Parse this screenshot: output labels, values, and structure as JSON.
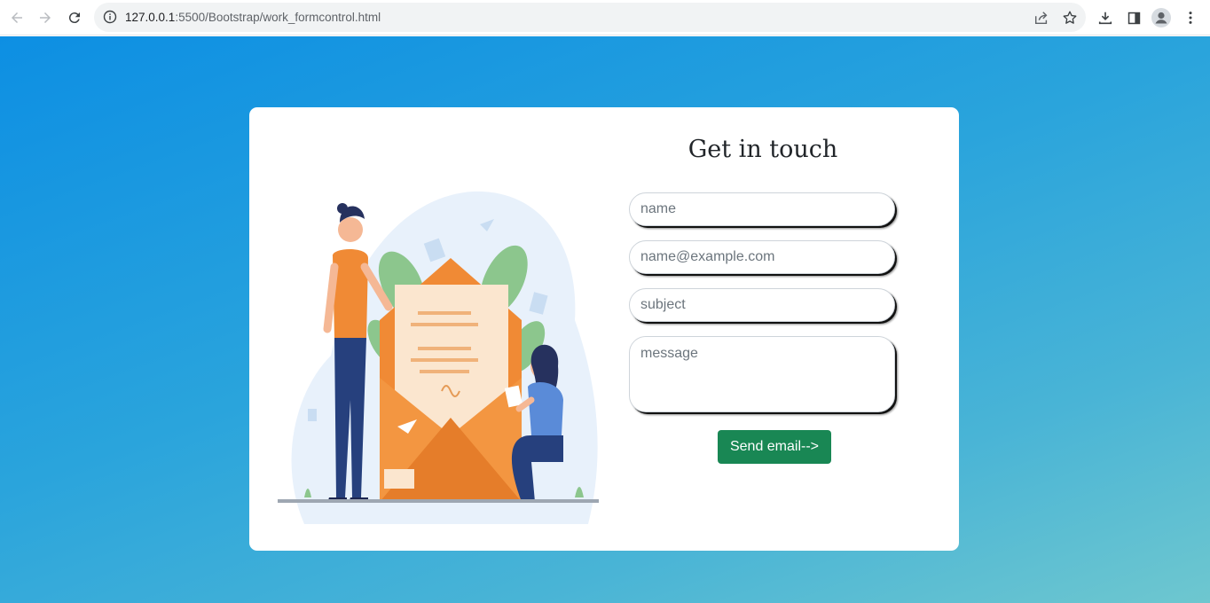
{
  "browser": {
    "url_host": "127.0.0.1",
    "url_path": ":5500/Bootstrap/work_formcontrol.html",
    "icons": [
      "back-arrow-icon",
      "forward-arrow-icon",
      "reload-icon",
      "site-info-icon",
      "share-icon",
      "bookmark-star-icon",
      "download-icon",
      "side-panel-icon",
      "profile-icon",
      "more-menu-icon"
    ]
  },
  "contact": {
    "title": "Get in touch",
    "name_placeholder": "name",
    "email_placeholder": "name@example.com",
    "subject_placeholder": "subject",
    "message_placeholder": "message",
    "send_label": "Send email-->"
  },
  "colors": {
    "page_gradient_start": "#0d8fe3",
    "page_gradient_end": "#6ec7cf",
    "send_button": "#198754",
    "envelope_orange": "#f08a35"
  }
}
